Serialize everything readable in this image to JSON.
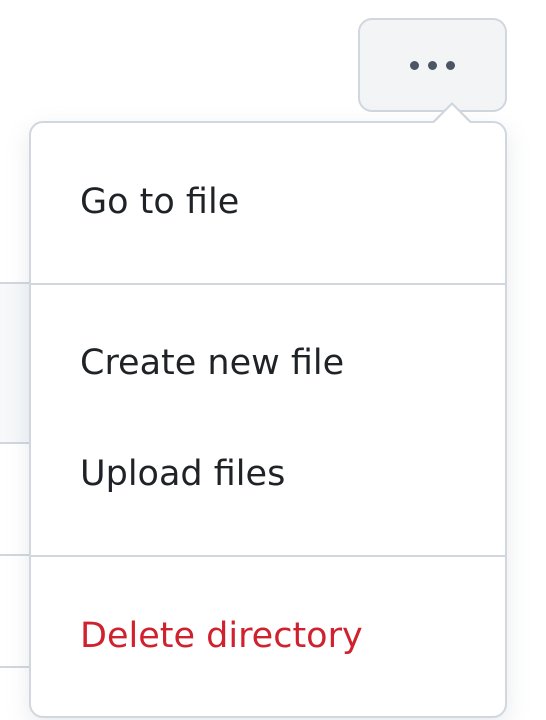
{
  "trigger": {
    "icon": "kebab-horizontal-icon"
  },
  "menu": {
    "sections": [
      {
        "items": [
          {
            "label": "Go to file"
          }
        ]
      },
      {
        "items": [
          {
            "label": "Create new file"
          },
          {
            "label": "Upload files"
          }
        ]
      },
      {
        "items": [
          {
            "label": "Delete directory",
            "variant": "danger"
          }
        ]
      }
    ]
  },
  "colors": {
    "text": "#1f2328",
    "danger": "#cf222e",
    "border": "#d0d7de",
    "button_bg": "#f3f4f6"
  }
}
